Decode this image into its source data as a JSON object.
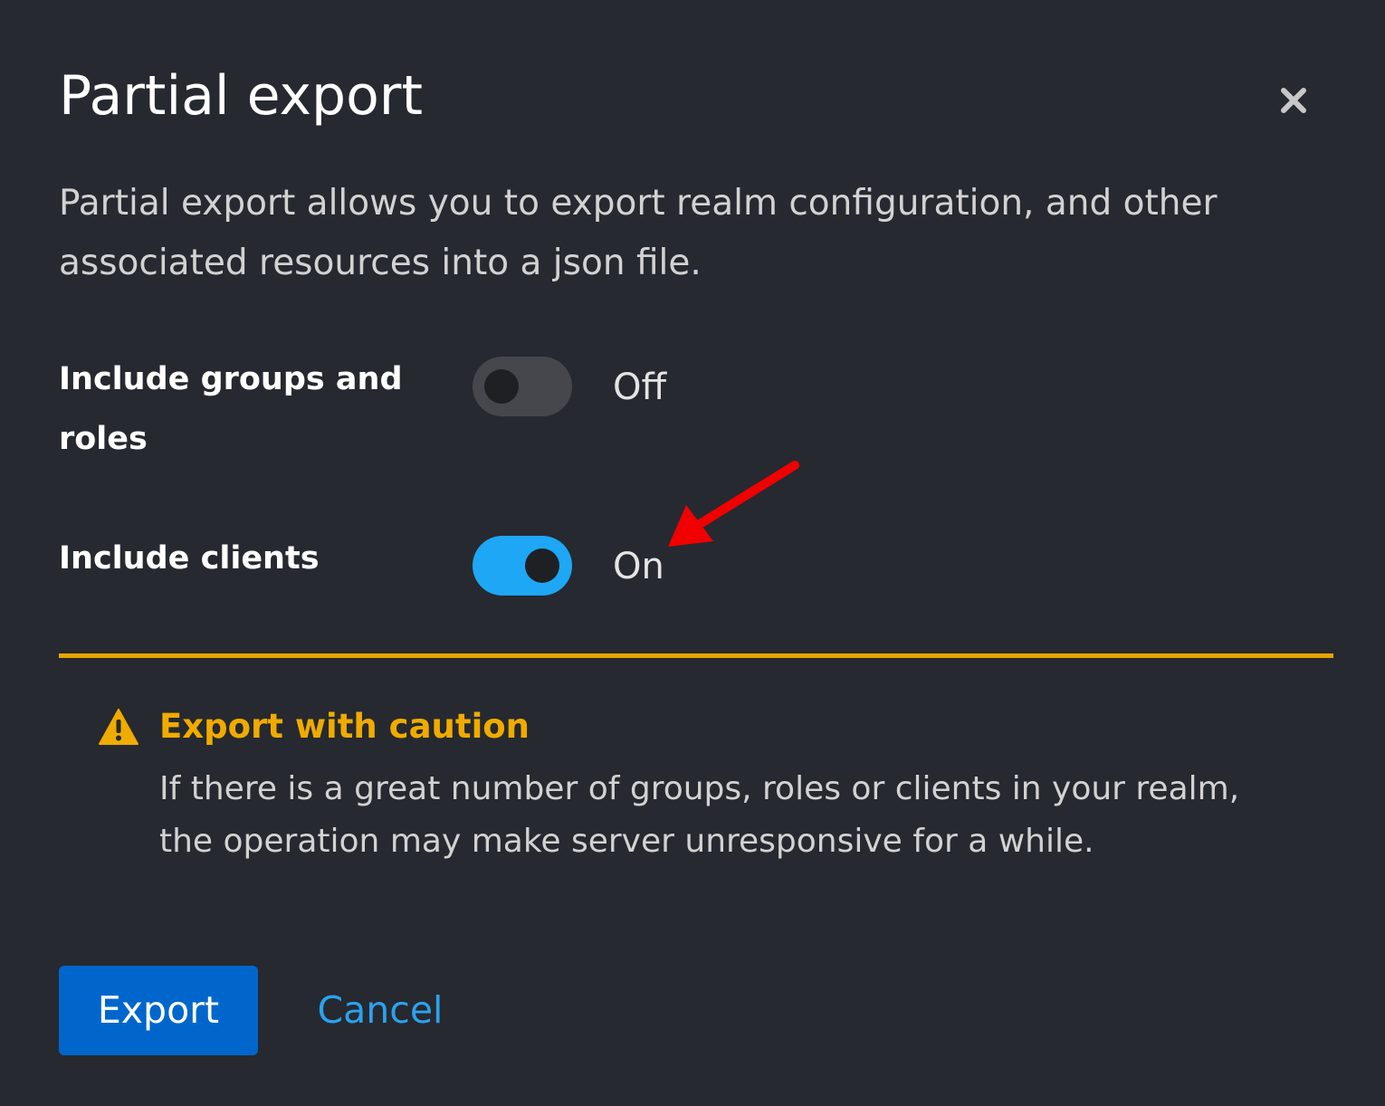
{
  "modal": {
    "title": "Partial export",
    "close_icon": "close-icon",
    "description": "Partial export allows you to export realm configuration, and other associated resources into a json file."
  },
  "fields": {
    "groups_roles": {
      "label": "Include groups and roles",
      "enabled": false,
      "state_text": "Off"
    },
    "clients": {
      "label": "Include clients",
      "enabled": true,
      "state_text": "On"
    }
  },
  "alert": {
    "icon": "warning-triangle-icon",
    "title": "Export with caution",
    "body": "If there is a great number of groups, roles or clients in your realm, the operation may make server unresponsive for a while.",
    "accent_color": "#f0ab00"
  },
  "annotation": {
    "icon": "red-arrow-icon",
    "color": "#f00000"
  },
  "footer": {
    "export_label": "Export",
    "cancel_label": "Cancel"
  },
  "colors": {
    "background": "#26292f",
    "primary": "#0066cc",
    "switch_on": "#1ea7f5",
    "link": "#2ba2ef"
  }
}
